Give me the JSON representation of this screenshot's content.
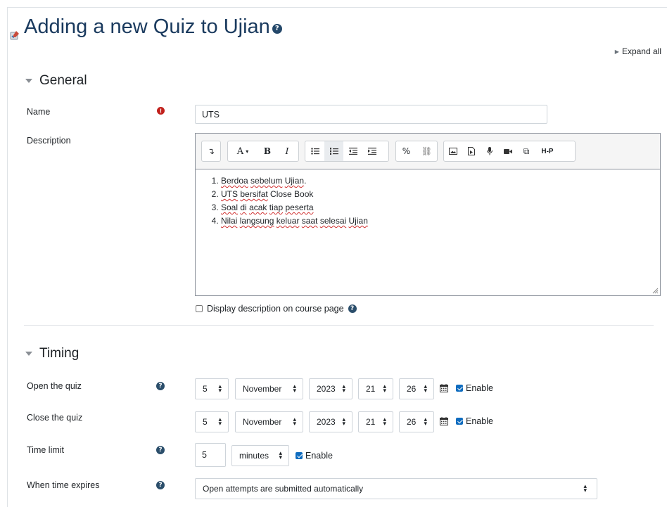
{
  "header": {
    "title": "Adding a new Quiz to Ujian",
    "expand_all": "Expand all"
  },
  "general": {
    "heading": "General",
    "name_label": "Name",
    "name_value": "UTS",
    "description_label": "Description",
    "description_items": [
      "Berdoa sebelum Ujian.",
      "UTS bersifat Close Book",
      "Soal di acak tiap peserta",
      "Nilai langsung keluar saat selesai Ujian"
    ],
    "display_description_label": "Display description on course page"
  },
  "toolbar": {
    "font": "A",
    "bold": "B",
    "italic": "I",
    "h5p": "H-P"
  },
  "timing": {
    "heading": "Timing",
    "open": {
      "label": "Open the quiz",
      "day": "5",
      "month": "November",
      "year": "2023",
      "hour": "21",
      "minute": "26",
      "enable": "Enable"
    },
    "close": {
      "label": "Close the quiz",
      "day": "5",
      "month": "November",
      "year": "2023",
      "hour": "21",
      "minute": "26",
      "enable": "Enable"
    },
    "time_limit": {
      "label": "Time limit",
      "value": "5",
      "unit": "minutes",
      "enable": "Enable"
    },
    "when_expires": {
      "label": "When time expires",
      "value": "Open attempts are submitted automatically"
    }
  },
  "colors": {
    "title": "#1a3a5e",
    "required": "#c1211c",
    "help": "#24486a",
    "checkbox": "#0f6cbf"
  }
}
